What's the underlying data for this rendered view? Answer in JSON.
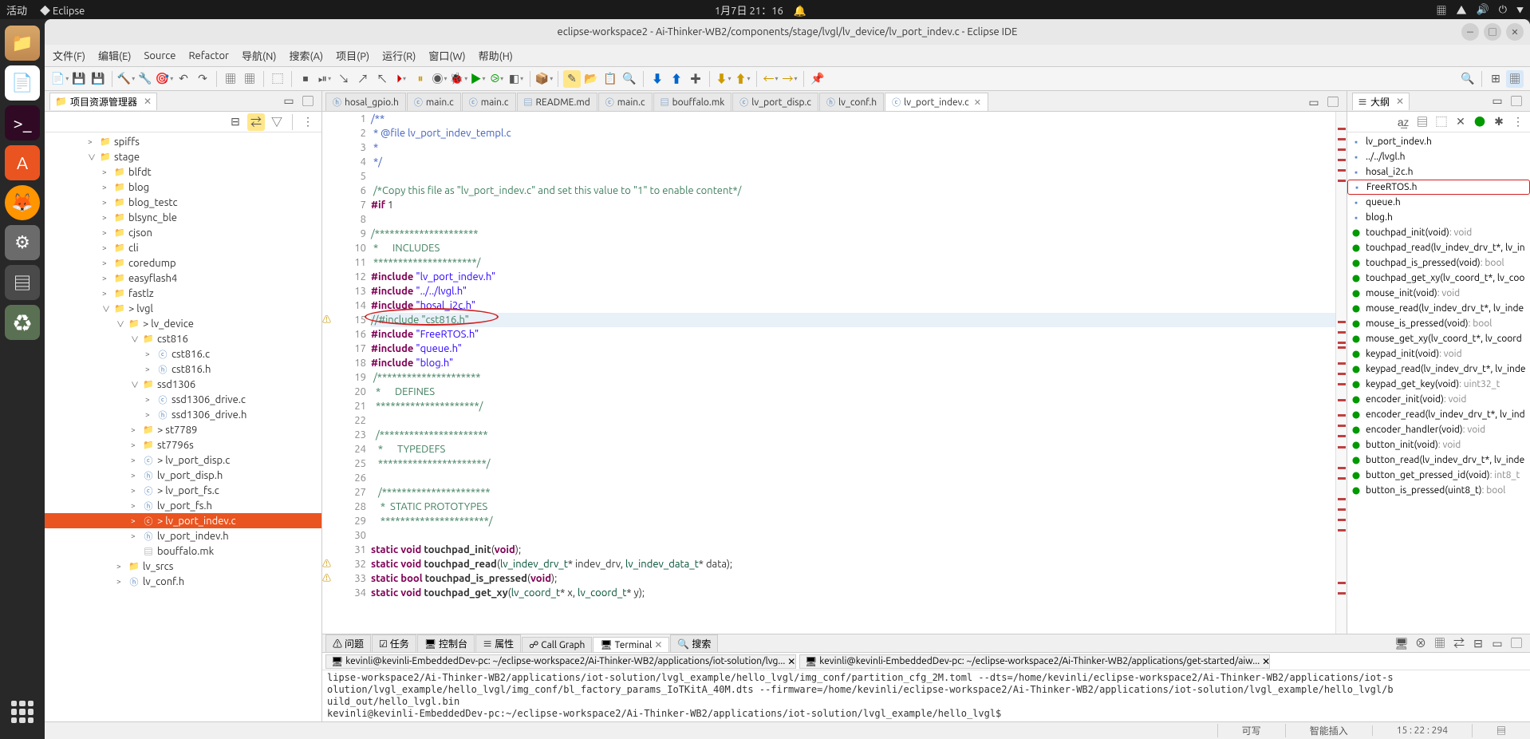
{
  "gnome": {
    "activities": "活动",
    "app": "Eclipse",
    "datetime": "1月7日 21：16",
    "bell": "🔔"
  },
  "window": {
    "title": "eclipse-workspace2 - Ai-Thinker-WB2/components/stage/lvgl/lv_device/lv_port_indev.c - Eclipse IDE"
  },
  "menu": [
    "文件(F)",
    "编辑(E)",
    "Source",
    "Refactor",
    "导航(N)",
    "搜索(A)",
    "项目(P)",
    "运行(R)",
    "窗口(W)",
    "帮助(H)"
  ],
  "project_explorer": {
    "title": "项目资源管理器",
    "tree": [
      {
        "depth": 3,
        "arrow": ">",
        "icon": "📁",
        "label": "spiffs"
      },
      {
        "depth": 3,
        "arrow": "∨",
        "icon": "📁",
        "label": "stage"
      },
      {
        "depth": 4,
        "arrow": ">",
        "icon": "📁",
        "label": "blfdt"
      },
      {
        "depth": 4,
        "arrow": ">",
        "icon": "📁",
        "label": "blog"
      },
      {
        "depth": 4,
        "arrow": ">",
        "icon": "📁",
        "label": "blog_testc"
      },
      {
        "depth": 4,
        "arrow": ">",
        "icon": "📁",
        "label": "blsync_ble"
      },
      {
        "depth": 4,
        "arrow": ">",
        "icon": "📁",
        "label": "cjson"
      },
      {
        "depth": 4,
        "arrow": ">",
        "icon": "📁",
        "label": "cli"
      },
      {
        "depth": 4,
        "arrow": ">",
        "icon": "📁",
        "label": "coredump"
      },
      {
        "depth": 4,
        "arrow": ">",
        "icon": "📁",
        "label": "easyflash4"
      },
      {
        "depth": 4,
        "arrow": ">",
        "icon": "📁",
        "label": "fastlz"
      },
      {
        "depth": 4,
        "arrow": "∨",
        "icon": "📁",
        "label": "> lvgl"
      },
      {
        "depth": 5,
        "arrow": "∨",
        "icon": "📁",
        "label": "> lv_device"
      },
      {
        "depth": 6,
        "arrow": "∨",
        "icon": "📁",
        "label": "cst816"
      },
      {
        "depth": 7,
        "arrow": ">",
        "icon": "c",
        "label": "cst816.c"
      },
      {
        "depth": 7,
        "arrow": ">",
        "icon": "h",
        "label": "cst816.h"
      },
      {
        "depth": 6,
        "arrow": "∨",
        "icon": "📁",
        "label": "ssd1306"
      },
      {
        "depth": 7,
        "arrow": ">",
        "icon": "c",
        "label": "ssd1306_drive.c"
      },
      {
        "depth": 7,
        "arrow": ">",
        "icon": "h",
        "label": "ssd1306_drive.h"
      },
      {
        "depth": 6,
        "arrow": ">",
        "icon": "📁",
        "label": "> st7789"
      },
      {
        "depth": 6,
        "arrow": ">",
        "icon": "📁",
        "label": "st7796s"
      },
      {
        "depth": 6,
        "arrow": ">",
        "icon": "c",
        "label": "> lv_port_disp.c"
      },
      {
        "depth": 6,
        "arrow": ">",
        "icon": "h",
        "label": "lv_port_disp.h"
      },
      {
        "depth": 6,
        "arrow": ">",
        "icon": "c",
        "label": "> lv_port_fs.c"
      },
      {
        "depth": 6,
        "arrow": ">",
        "icon": "h",
        "label": "lv_port_fs.h"
      },
      {
        "depth": 6,
        "arrow": ">",
        "icon": "c",
        "label": "> lv_port_indev.c",
        "selected": true
      },
      {
        "depth": 6,
        "arrow": ">",
        "icon": "h",
        "label": "lv_port_indev.h"
      },
      {
        "depth": 6,
        "arrow": "",
        "icon": "mk",
        "label": "bouffalo.mk"
      },
      {
        "depth": 5,
        "arrow": ">",
        "icon": "📁",
        "label": "lv_srcs"
      },
      {
        "depth": 5,
        "arrow": ">",
        "icon": "h",
        "label": "lv_conf.h"
      }
    ]
  },
  "editor": {
    "tabs": [
      {
        "icon": "h",
        "label": "hosal_gpio.h"
      },
      {
        "icon": "c",
        "label": "main.c"
      },
      {
        "icon": "c",
        "label": "main.c"
      },
      {
        "icon": "md",
        "label": "README.md"
      },
      {
        "icon": "c",
        "label": "main.c"
      },
      {
        "icon": "mk",
        "label": "bouffalo.mk"
      },
      {
        "icon": "c",
        "label": "lv_port_disp.c"
      },
      {
        "icon": "h",
        "label": "lv_conf.h"
      },
      {
        "icon": "c",
        "label": "lv_port_indev.c",
        "active": true,
        "close": true
      }
    ],
    "lines": [
      {
        "n": 1,
        "html": "<span class='doc'>/**</span>"
      },
      {
        "n": 2,
        "html": "<span class='doc'> * @file lv_port_indev_templ.c</span>"
      },
      {
        "n": 3,
        "html": "<span class='doc'> *</span>"
      },
      {
        "n": 4,
        "html": "<span class='doc'> */</span>"
      },
      {
        "n": 5,
        "html": ""
      },
      {
        "n": 6,
        "html": " <span class='cmt'>/*Copy this file as \"lv_port_indev.c\" and set this value to \"1\" to enable content*/</span>"
      },
      {
        "n": 7,
        "html": "<span class='kw'>#if</span> 1"
      },
      {
        "n": 8,
        "html": ""
      },
      {
        "n": 9,
        "html": "<span class='cmt'>/*********************</span>"
      },
      {
        "n": 10,
        "html": "<span class='cmt'> *      INCLUDES</span>"
      },
      {
        "n": 11,
        "html": "<span class='cmt'> *********************/</span>"
      },
      {
        "n": 12,
        "html": "<span class='kw'>#include</span> <span class='str'>\"lv_port_indev.h\"</span>"
      },
      {
        "n": 13,
        "html": "<span class='kw'>#include</span> <span class='str'>\"../../lvgl.h\"</span>"
      },
      {
        "n": 14,
        "html": "<span class='kw'>#include</span> <span class='str'>\"hosal_i2c.h\"</span>"
      },
      {
        "n": 15,
        "html": "<span class='cmt'>//#include \"cst816.h\"</span>",
        "hl": true,
        "ellipse": true
      },
      {
        "n": 16,
        "html": "<span class='kw'>#include</span> <span class='str'>\"FreeRTOS.h\"</span>"
      },
      {
        "n": 17,
        "html": "<span class='kw'>#include</span> <span class='str'>\"queue.h\"</span>"
      },
      {
        "n": 18,
        "html": "<span class='kw'>#include</span> <span class='str'>\"blog.h\"</span>"
      },
      {
        "n": 19,
        "html": " <span class='cmt'>/*********************</span>"
      },
      {
        "n": 20,
        "html": "<span class='cmt'>  *      DEFINES</span>"
      },
      {
        "n": 21,
        "html": "<span class='cmt'>  *********************/</span>"
      },
      {
        "n": 22,
        "html": ""
      },
      {
        "n": 23,
        "html": "  <span class='cmt'>/**********************</span>"
      },
      {
        "n": 24,
        "html": "<span class='cmt'>   *      TYPEDEFS</span>"
      },
      {
        "n": 25,
        "html": "<span class='cmt'>   **********************/</span>"
      },
      {
        "n": 26,
        "html": ""
      },
      {
        "n": 27,
        "html": "   <span class='cmt'>/**********************</span>"
      },
      {
        "n": 28,
        "html": "<span class='cmt'>    *  STATIC PROTOTYPES</span>"
      },
      {
        "n": 29,
        "html": "<span class='cmt'>    **********************/</span>"
      },
      {
        "n": 30,
        "html": ""
      },
      {
        "n": 31,
        "html": "<span class='kw'>static void</span> <span class='func'>touchpad_init</span>(<span class='kw'>void</span>);"
      },
      {
        "n": 32,
        "html": "<span class='kw'>static void</span> <span class='func'>touchpad_read</span>(<span class='type'>lv_indev_drv_t</span>* indev_drv, <span class='type'>lv_indev_data_t</span>* data);"
      },
      {
        "n": 33,
        "html": "<span class='kw'>static bool</span> <span class='func'>touchpad_is_pressed</span>(<span class='kw'>void</span>);"
      },
      {
        "n": 34,
        "html": "<span class='kw'>static void</span> <span class='func'>touchpad_get_xy</span>(<span class='type'>lv_coord_t</span>* x, <span class='type'>lv_coord_t</span>* y);"
      }
    ]
  },
  "outline": {
    "title": "大纲",
    "items": [
      {
        "icon": "h",
        "label": "lv_port_indev.h"
      },
      {
        "icon": "h",
        "label": "../../lvgl.h"
      },
      {
        "icon": "h",
        "label": "hosal_i2c.h"
      },
      {
        "icon": "h",
        "label": "FreeRTOS.h",
        "selected": true
      },
      {
        "icon": "h",
        "label": "queue.h"
      },
      {
        "icon": "h",
        "label": "blog.h"
      },
      {
        "icon": "f",
        "label": "touchpad_init(void)",
        "ret": ": void"
      },
      {
        "icon": "f",
        "label": "touchpad_read(lv_indev_drv_t*, lv_in"
      },
      {
        "icon": "f",
        "label": "touchpad_is_pressed(void)",
        "ret": ": bool"
      },
      {
        "icon": "f",
        "label": "touchpad_get_xy(lv_coord_t*, lv_coo"
      },
      {
        "icon": "f",
        "label": "mouse_init(void)",
        "ret": ": void"
      },
      {
        "icon": "f",
        "label": "mouse_read(lv_indev_drv_t*, lv_inde"
      },
      {
        "icon": "f",
        "label": "mouse_is_pressed(void)",
        "ret": ": bool"
      },
      {
        "icon": "f",
        "label": "mouse_get_xy(lv_coord_t*, lv_coord"
      },
      {
        "icon": "f",
        "label": "keypad_init(void)",
        "ret": ": void"
      },
      {
        "icon": "f",
        "label": "keypad_read(lv_indev_drv_t*, lv_inde"
      },
      {
        "icon": "f",
        "label": "keypad_get_key(void)",
        "ret": ": uint32_t"
      },
      {
        "icon": "f",
        "label": "encoder_init(void)",
        "ret": ": void"
      },
      {
        "icon": "f",
        "label": "encoder_read(lv_indev_drv_t*, lv_ind"
      },
      {
        "icon": "f",
        "label": "encoder_handler(void)",
        "ret": ": void"
      },
      {
        "icon": "f",
        "label": "button_init(void)",
        "ret": ": void"
      },
      {
        "icon": "f",
        "label": "button_read(lv_indev_drv_t*, lv_inde"
      },
      {
        "icon": "f",
        "label": "button_get_pressed_id(void)",
        "ret": ": int8_t"
      },
      {
        "icon": "f",
        "label": "button_is_pressed(uint8_t)",
        "ret": ": bool"
      }
    ]
  },
  "bottom": {
    "tabs": [
      "问题",
      "任务",
      "控制台",
      "属性",
      "Call Graph",
      "Terminal",
      "搜索"
    ],
    "active": 5,
    "term_tabs": [
      "kevinli@kevinli-EmbeddedDev-pc: ~/eclipse-workspace2/Ai-Thinker-WB2/applications/iot-solution/lvg...",
      "kevinli@kevinli-EmbeddedDev-pc: ~/eclipse-workspace2/Ai-Thinker-WB2/applications/get-started/aiw..."
    ],
    "term_output": "lipse-workspace2/Ai-Thinker-WB2/applications/iot-solution/lvgl_example/hello_lvgl/img_conf/partition_cfg_2M.toml --dts=/home/kevinli/eclipse-workspace2/Ai-Thinker-WB2/applications/iot-s\nolution/lvgl_example/hello_lvgl/img_conf/bl_factory_params_IoTKitA_40M.dts --firmware=/home/kevinli/eclipse-workspace2/Ai-Thinker-WB2/applications/iot-solution/lvgl_example/hello_lvgl/b\nuild_out/hello_lvgl.bin\nkevinli@kevinli-EmbeddedDev-pc:~/eclipse-workspace2/Ai-Thinker-WB2/applications/iot-solution/lvgl_example/hello_lvgl$"
  },
  "status": {
    "writable": "可写",
    "insert": "智能插入",
    "pos": "15 : 22 : 294"
  }
}
